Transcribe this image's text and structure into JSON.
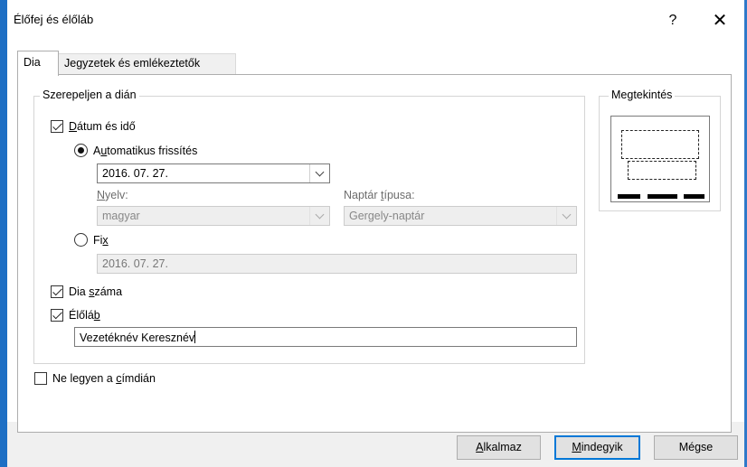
{
  "window": {
    "title": "Élőfej és élőláb",
    "help_label": "?",
    "close_label": "✕"
  },
  "tabs": [
    {
      "label": "Dia",
      "active": true
    },
    {
      "label": "Jegyzetek és emlékeztetők",
      "active": false
    }
  ],
  "include_group": {
    "legend": "Szerepeljen a dián",
    "date_time": {
      "label_underlined": "D",
      "label_rest": "átum és idő",
      "checked": true
    },
    "auto_update": {
      "label_prefix": "A",
      "label_underlined": "u",
      "label_rest": "tomatikus frissítés",
      "selected": true,
      "date_value": "2016. 07. 27."
    },
    "language": {
      "label_underlined": "N",
      "label_rest": "yelv:",
      "value": "magyar"
    },
    "calendar": {
      "label_prefix": "Naptár ",
      "label_underlined": "t",
      "label_rest": "ípusa:",
      "value": "Gergely-naptár"
    },
    "fixed": {
      "label_prefix": "Fi",
      "label_underlined": "x",
      "selected": false,
      "value": "2016. 07. 27."
    },
    "slide_number": {
      "label_prefix": "Dia ",
      "label_underlined": "s",
      "label_rest": "záma",
      "checked": true
    },
    "footer": {
      "label_prefix": "Élőlá",
      "label_underlined": "b",
      "checked": true,
      "value": "Vezetéknév Keresznév"
    }
  },
  "title_slide": {
    "label_prefix": "Ne legyen a ",
    "label_underlined": "c",
    "label_rest": "ímdián",
    "checked": false
  },
  "preview": {
    "legend": "Megtekintés"
  },
  "buttons": {
    "apply_underlined": "A",
    "apply_rest": "lkalmaz",
    "apply_all_underlined": "M",
    "apply_all_rest": "indegyik",
    "cancel": "Mégse"
  },
  "colors": {
    "accent": "#0078d7",
    "window_edge": "#1e6fc4"
  }
}
